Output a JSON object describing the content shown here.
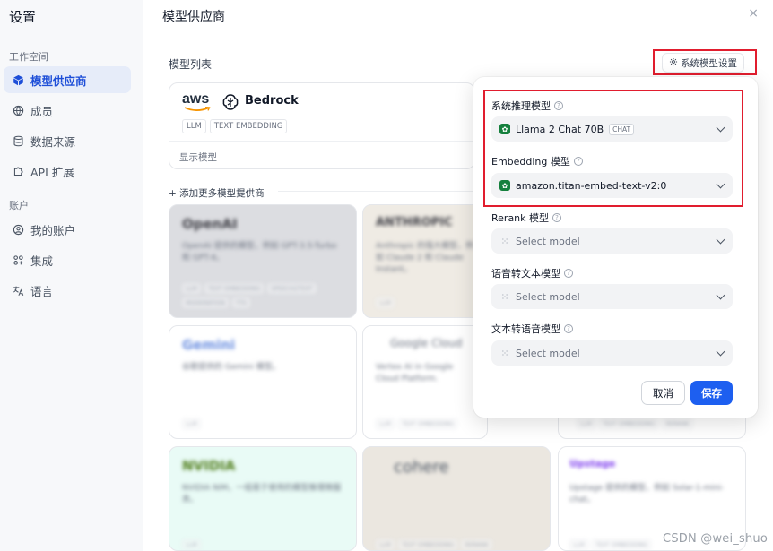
{
  "sidebar": {
    "title": "设置",
    "section_workspace": "工作空间",
    "section_account": "账户",
    "items": [
      {
        "label": "模型供应商",
        "icon": "cube-icon",
        "active": true
      },
      {
        "label": "成员",
        "icon": "globe-icon",
        "active": false
      },
      {
        "label": "数据来源",
        "icon": "database-icon",
        "active": false
      },
      {
        "label": "API 扩展",
        "icon": "puzzle-icon",
        "active": false
      },
      {
        "label": "我的账户",
        "icon": "user-circle-icon",
        "active": false
      },
      {
        "label": "集成",
        "icon": "integration-icon",
        "active": false
      },
      {
        "label": "语言",
        "icon": "translate-icon",
        "active": false
      }
    ]
  },
  "main": {
    "title": "模型供应商",
    "close": "×",
    "list_label": "模型列表",
    "system_settings_button": "系统模型设置",
    "bedrock": {
      "aws": "aws",
      "name": "Bedrock",
      "tags": [
        "LLM",
        "TEXT EMBEDDING"
      ],
      "show_models": "显示模型"
    },
    "add_more": "+ 添加更多模型提供商",
    "providers": [
      {
        "name": "OpenAI",
        "desc": "OpenAI 提供的模型，例如 GPT-3.5-Turbo 和 GPT-4。",
        "tags": [
          "LLM",
          "TEXT EMBEDDING",
          "SPEECH2TEXT",
          "MODERATION",
          "TTS"
        ]
      },
      {
        "name": "ANTHROPIC",
        "desc": "Anthropic 的强大模型，例如 Claude 2 和 Claude Instant。",
        "tags": [
          "LLM"
        ]
      },
      {
        "name": "Gemini",
        "desc": "谷歌提供的 Gemini 模型。",
        "tags": [
          "LLM"
        ]
      },
      {
        "name": "Google Cloud",
        "desc": "Vertex AI in Google Cloud Platform.",
        "tags": [
          "LLM",
          "TEXT EMBEDDING"
        ]
      },
      {
        "name": "",
        "desc": "",
        "tags": [
          "LLM",
          "TEXT EMBEDDING",
          "RERANK"
        ]
      },
      {
        "name": "NVIDIA",
        "desc": "NVIDIA NIM，一组易于使用的模型推理微服务。",
        "tags": [
          "LLM"
        ]
      },
      {
        "name": "cohere",
        "desc": "",
        "tags": [
          "LLM",
          "TEXT EMBEDDING",
          "RERANK"
        ]
      },
      {
        "name": "Upstage",
        "desc": "Upstage 提供的模型，例如 Solar-1-mini-chat。",
        "tags": [
          "LLM",
          "TEXT EMBEDDING"
        ]
      }
    ]
  },
  "panel": {
    "reasoning": {
      "label": "系统推理模型",
      "value": "Llama 2 Chat 70B",
      "badge": "CHAT"
    },
    "embedding": {
      "label": "Embedding 模型",
      "value": "amazon.titan-embed-text-v2:0"
    },
    "rerank": {
      "label": "Rerank 模型",
      "placeholder": "Select model"
    },
    "stt": {
      "label": "语音转文本模型",
      "placeholder": "Select model"
    },
    "tts": {
      "label": "文本转语音模型",
      "placeholder": "Select model"
    },
    "cancel": "取消",
    "save": "保存",
    "help": "?"
  },
  "watermark": "CSDN @wei_shuo",
  "colors": {
    "accent": "#1d5ff0",
    "highlight": "#e11d2e",
    "model_icon": "#15803d"
  }
}
